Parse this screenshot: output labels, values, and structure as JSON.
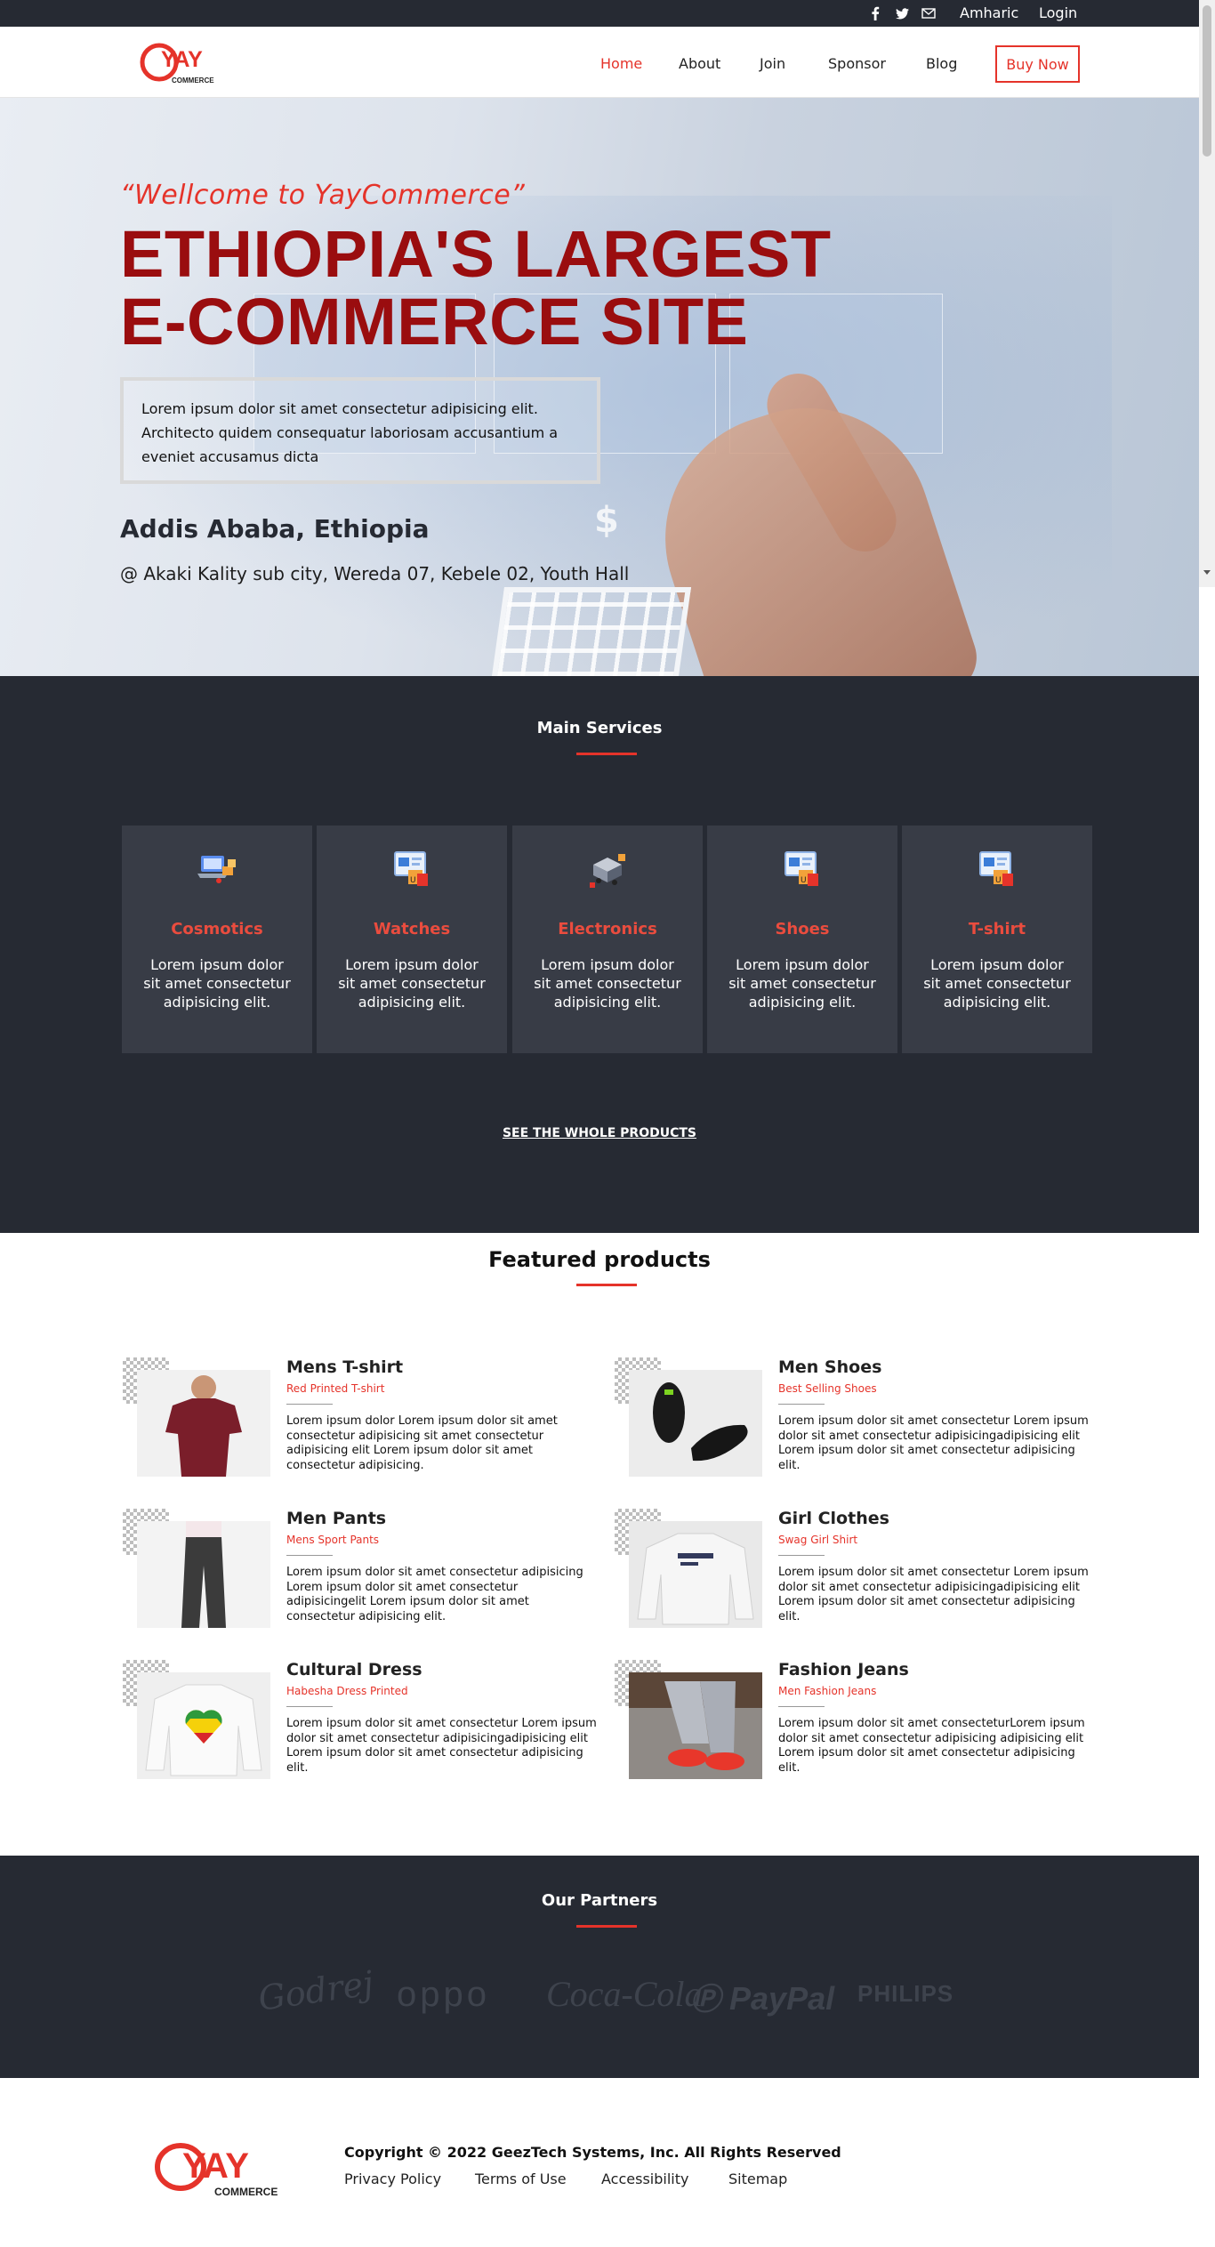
{
  "topbar": {
    "social_icons": [
      "facebook-icon",
      "twitter-icon",
      "mail-icon"
    ],
    "amharic_label": "Amharic",
    "login_label": "Login"
  },
  "brand": {
    "logo_text": "YAY",
    "logo_sub": "COMMERCE",
    "accent_color": "#e5332a",
    "dark_color": "#262a33"
  },
  "nav": {
    "items": [
      "Home",
      "About",
      "Join",
      "Sponsor",
      "Blog"
    ],
    "active": "Home",
    "cta_label": "Buy Now"
  },
  "hero": {
    "quote": "“Wellcome to YayCommerce”",
    "headline_line1": "ETHIOPIA'S LARGEST",
    "headline_line2": "E-COMMERCE SITE",
    "lorem": "Lorem ipsum dolor sit amet consectetur adipisicing elit. Architecto quidem consequatur laboriosam accusantium a eveniet accusamus dicta",
    "city": "Addis Ababa, Ethiopia",
    "address": "@ Akaki Kality sub city, Wereda 07, Kebele 02, Youth Hall"
  },
  "services": {
    "title": "Main Services",
    "items": [
      {
        "name": "Cosmotics",
        "icon": "laptop-shopping-icon",
        "desc": "Lorem ipsum dolor sit amet consectetur adipisicing elit."
      },
      {
        "name": "Watches",
        "icon": "online-store-icon",
        "desc": "Lorem ipsum dolor sit amet consectetur adipisicing elit."
      },
      {
        "name": "Electronics",
        "icon": "delivery-truck-icon",
        "desc": "Lorem ipsum dolor sit amet consectetur adipisicing elit."
      },
      {
        "name": "Shoes",
        "icon": "online-store-icon",
        "desc": "Lorem ipsum dolor sit amet consectetur adipisicing elit."
      },
      {
        "name": "T-shirt",
        "icon": "online-store-icon",
        "desc": "Lorem ipsum dolor sit amet consectetur adipisicing elit."
      }
    ],
    "see_all_label": "SEE THE WHOLE PRODUCTS"
  },
  "featured": {
    "title": "Featured products",
    "products": [
      {
        "title": "Mens T-shirt",
        "subtitle": "Red Printed T-shirt",
        "image": "red-tshirt-photo",
        "desc": "Lorem ipsum dolor Lorem ipsum dolor sit amet consectetur adipisicing sit amet consectetur adipisicing elit Lorem ipsum dolor sit amet consectetur adipisicing."
      },
      {
        "title": "Men Shoes",
        "subtitle": "Best Selling Shoes",
        "image": "black-sneakers-photo",
        "desc": "Lorem ipsum dolor sit amet consectetur Lorem ipsum dolor sit amet consectetur adipisicingadipisicing elit Lorem ipsum dolor sit amet consectetur adipisicing elit."
      },
      {
        "title": "Men Pants",
        "subtitle": "Mens Sport Pants",
        "image": "sport-pants-photo",
        "desc": "Lorem ipsum dolor sit amet consectetur adipisicing Lorem ipsum dolor sit amet consectetur adipisicingelit Lorem ipsum dolor sit amet consectetur adipisicing elit."
      },
      {
        "title": "Girl Clothes",
        "subtitle": "Swag Girl Shirt",
        "image": "white-sweatshirt-photo",
        "desc": "Lorem ipsum dolor sit amet consectetur Lorem ipsum dolor sit amet consectetur adipisicingadipisicing elit Lorem ipsum dolor sit amet consectetur adipisicing elit."
      },
      {
        "title": "Cultural Dress",
        "subtitle": "Habesha Dress Printed",
        "image": "ethiopia-heart-shirt-photo",
        "desc": "Lorem ipsum dolor sit amet consectetur Lorem ipsum dolor sit amet consectetur adipisicingadipisicing elit Lorem ipsum dolor sit amet consectetur adipisicing elit."
      },
      {
        "title": "Fashion Jeans",
        "subtitle": "Men Fashion Jeans",
        "image": "jeans-red-shoes-photo",
        "desc": "Lorem ipsum dolor sit amet consecteturLorem ipsum dolor sit amet consectetur adipisicing adipisicing elit Lorem ipsum dolor sit amet consectetur adipisicing elit."
      }
    ]
  },
  "partners": {
    "title": "Our Partners",
    "logos": [
      "Godrej",
      "oppo",
      "Coca-Cola",
      "PayPal",
      "PHILIPS"
    ]
  },
  "footer": {
    "copyright": "Copyright © 2022 GeezTech Systems, Inc. All Rights Reserved",
    "links": [
      "Privacy Policy",
      "Terms of Use",
      "Accessibility",
      "Sitemap"
    ]
  }
}
